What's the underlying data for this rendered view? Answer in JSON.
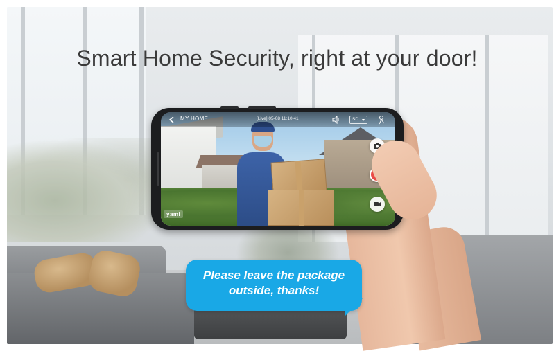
{
  "headline": "Smart Home Security, right at your door!",
  "phone": {
    "status_bar": {
      "back_icon": "chevron-left-icon",
      "title": "MY HOME",
      "datetime": "[Live] 05-08 11:10:41",
      "volume_icon": "speaker-icon",
      "quality": "SD",
      "user_icon": "person-icon"
    },
    "actions": [
      {
        "name": "snapshot",
        "icon": "camera-icon"
      },
      {
        "name": "talk",
        "icon": "microphone-icon"
      },
      {
        "name": "record",
        "icon": "video-camera-icon"
      }
    ],
    "brand": "yami"
  },
  "bubble": {
    "line1": "Please leave the package",
    "line2": "outside, thanks!"
  },
  "colors": {
    "bubble": "#19a8e6",
    "mic_button": "#e94b47",
    "headline": "#3a3a3a"
  }
}
